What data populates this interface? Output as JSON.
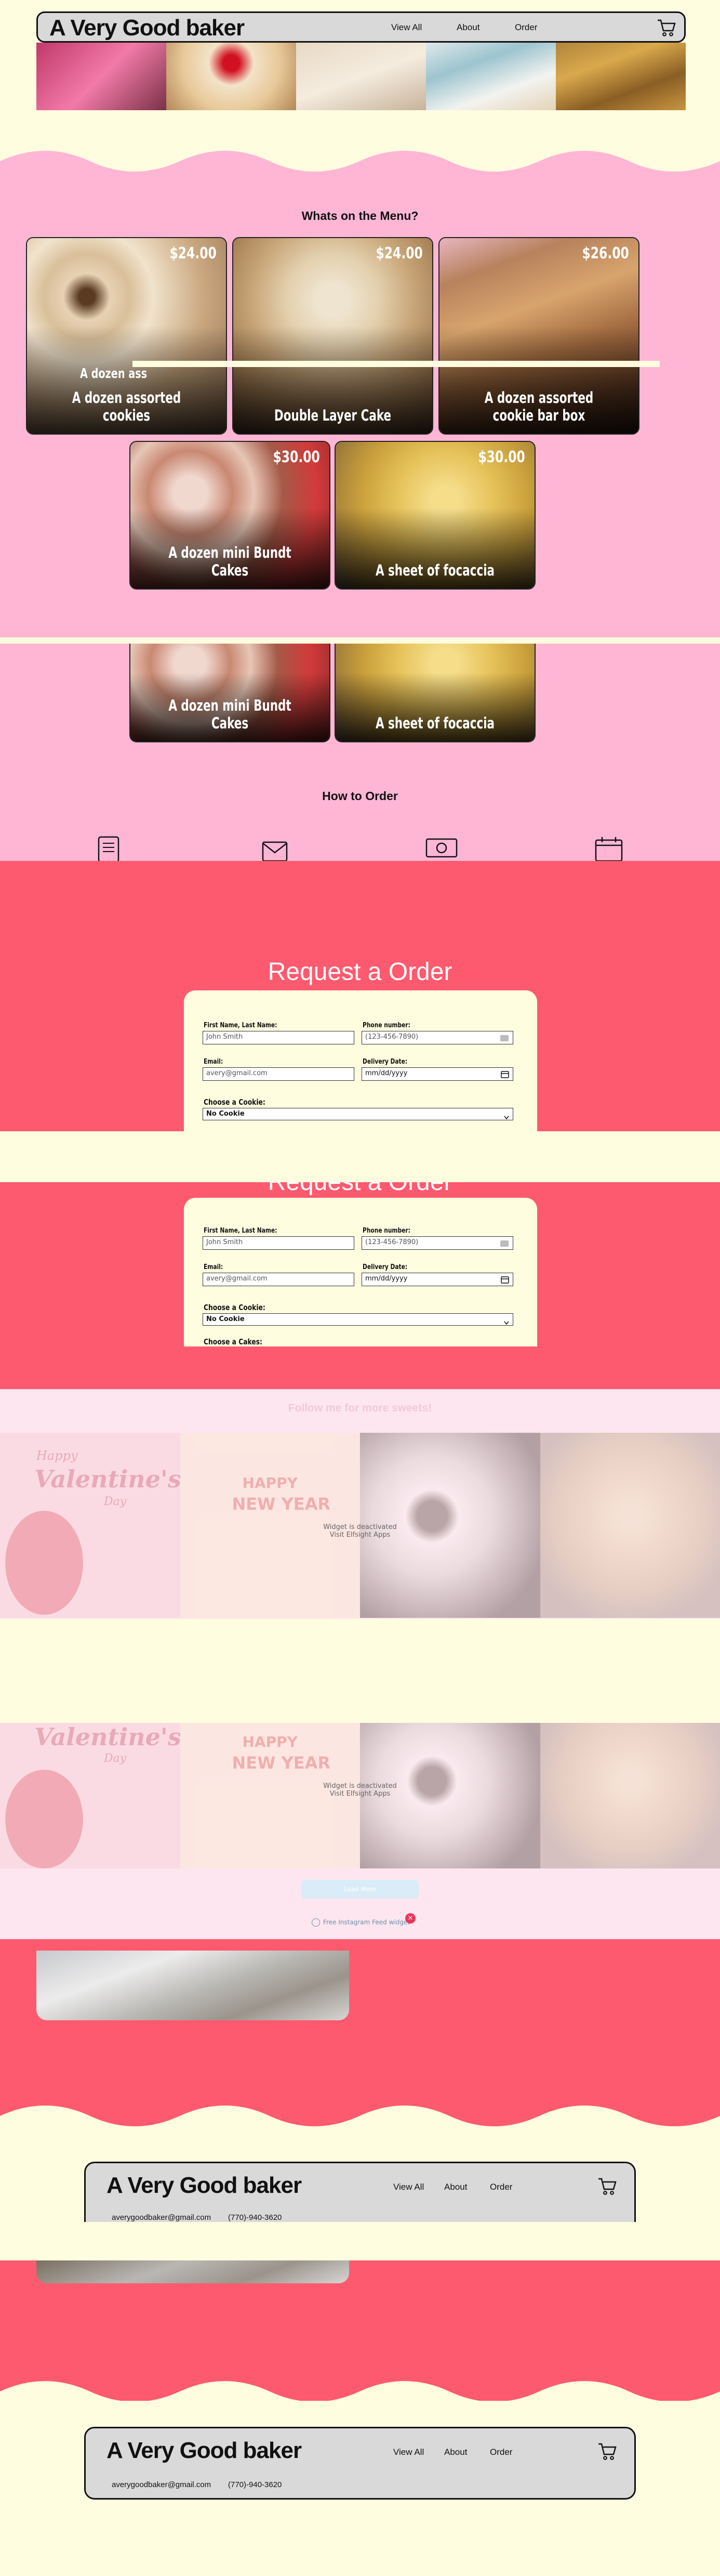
{
  "header": {
    "brand": "A Very Good baker",
    "nav": [
      "View All",
      "About",
      "Order"
    ]
  },
  "menu": {
    "title": "Whats on the Menu?",
    "items": [
      {
        "name": "A dozen assorted cookies",
        "price": "$24.00"
      },
      {
        "name": "Double Layer Cake",
        "price": "$24.00"
      },
      {
        "name": "A dozen assorted cookie bar box",
        "price": "$26.00"
      },
      {
        "name": "A dozen mini Bundt Cakes",
        "price": "$30.00"
      },
      {
        "name": "A sheet of focaccia",
        "price": "$30.00"
      }
    ],
    "partial_label": "A dozen ass"
  },
  "how": {
    "title": "How to Order"
  },
  "order": {
    "title": "Request a Order",
    "name_label": "First Name, Last Name:",
    "name_placeholder": "John Smith",
    "phone_label": "Phone number:",
    "phone_placeholder": "(123-456-7890)",
    "email_label": "Email:",
    "email_placeholder": "avery@gmail.com",
    "date_label": "Delivery Date:",
    "date_placeholder": "mm/dd/yyyy",
    "cookie_label": "Choose a Cookie:",
    "cookie_value": "No Cookie",
    "cake_label": "Choose a Cakes:"
  },
  "instagram": {
    "title": "Follow me for more sweets!",
    "notice1": "Widget is deactivated",
    "notice2": "Visit Elfsight Apps",
    "button": "Load More",
    "footer": "Free Instagram Feed widget",
    "tile_texts": [
      "Happy",
      "Valentine's",
      "Day",
      "HAPPY",
      "NEW YEAR"
    ]
  },
  "footer": {
    "email": "averygoodbaker@gmail.com",
    "phone": "(770)-940-3620"
  },
  "colors": {
    "cream": "#fffde0",
    "pink": "#ffb6d5",
    "coral": "#fe5a6f",
    "grey": "#d9d9d9"
  }
}
